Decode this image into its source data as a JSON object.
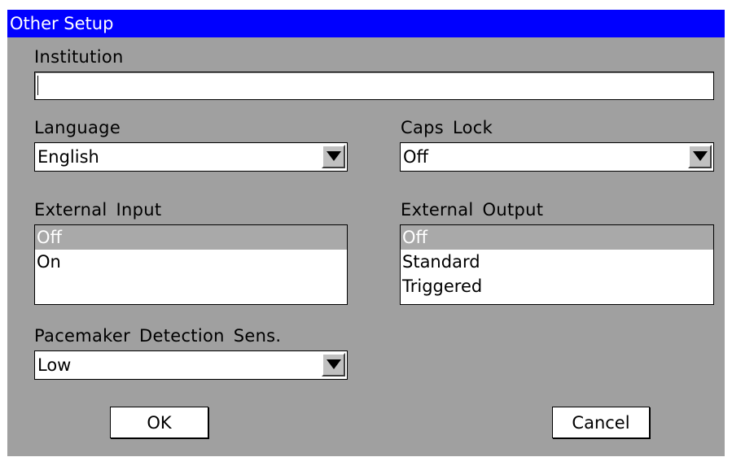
{
  "dialog": {
    "title": "Other Setup"
  },
  "institution": {
    "label": "Institution",
    "value": ""
  },
  "language": {
    "label": "Language",
    "value": "English"
  },
  "caps_lock": {
    "label": "Caps Lock",
    "value": "Off"
  },
  "external_input": {
    "label": "External Input",
    "options": [
      "Off",
      "On"
    ],
    "selected": "Off"
  },
  "external_output": {
    "label": "External Output",
    "options": [
      "Off",
      "Standard",
      "Triggered"
    ],
    "selected": "Off"
  },
  "pacemaker": {
    "label": "Pacemaker Detection Sens.",
    "value": "Low"
  },
  "buttons": {
    "ok": "OK",
    "cancel": "Cancel"
  },
  "icons": {
    "dropdown": "triangle-down-icon"
  },
  "colors": {
    "titlebar": "#0000ff",
    "dialog_background": "#a0a0a0",
    "selected_item": "#a9a9a9"
  }
}
